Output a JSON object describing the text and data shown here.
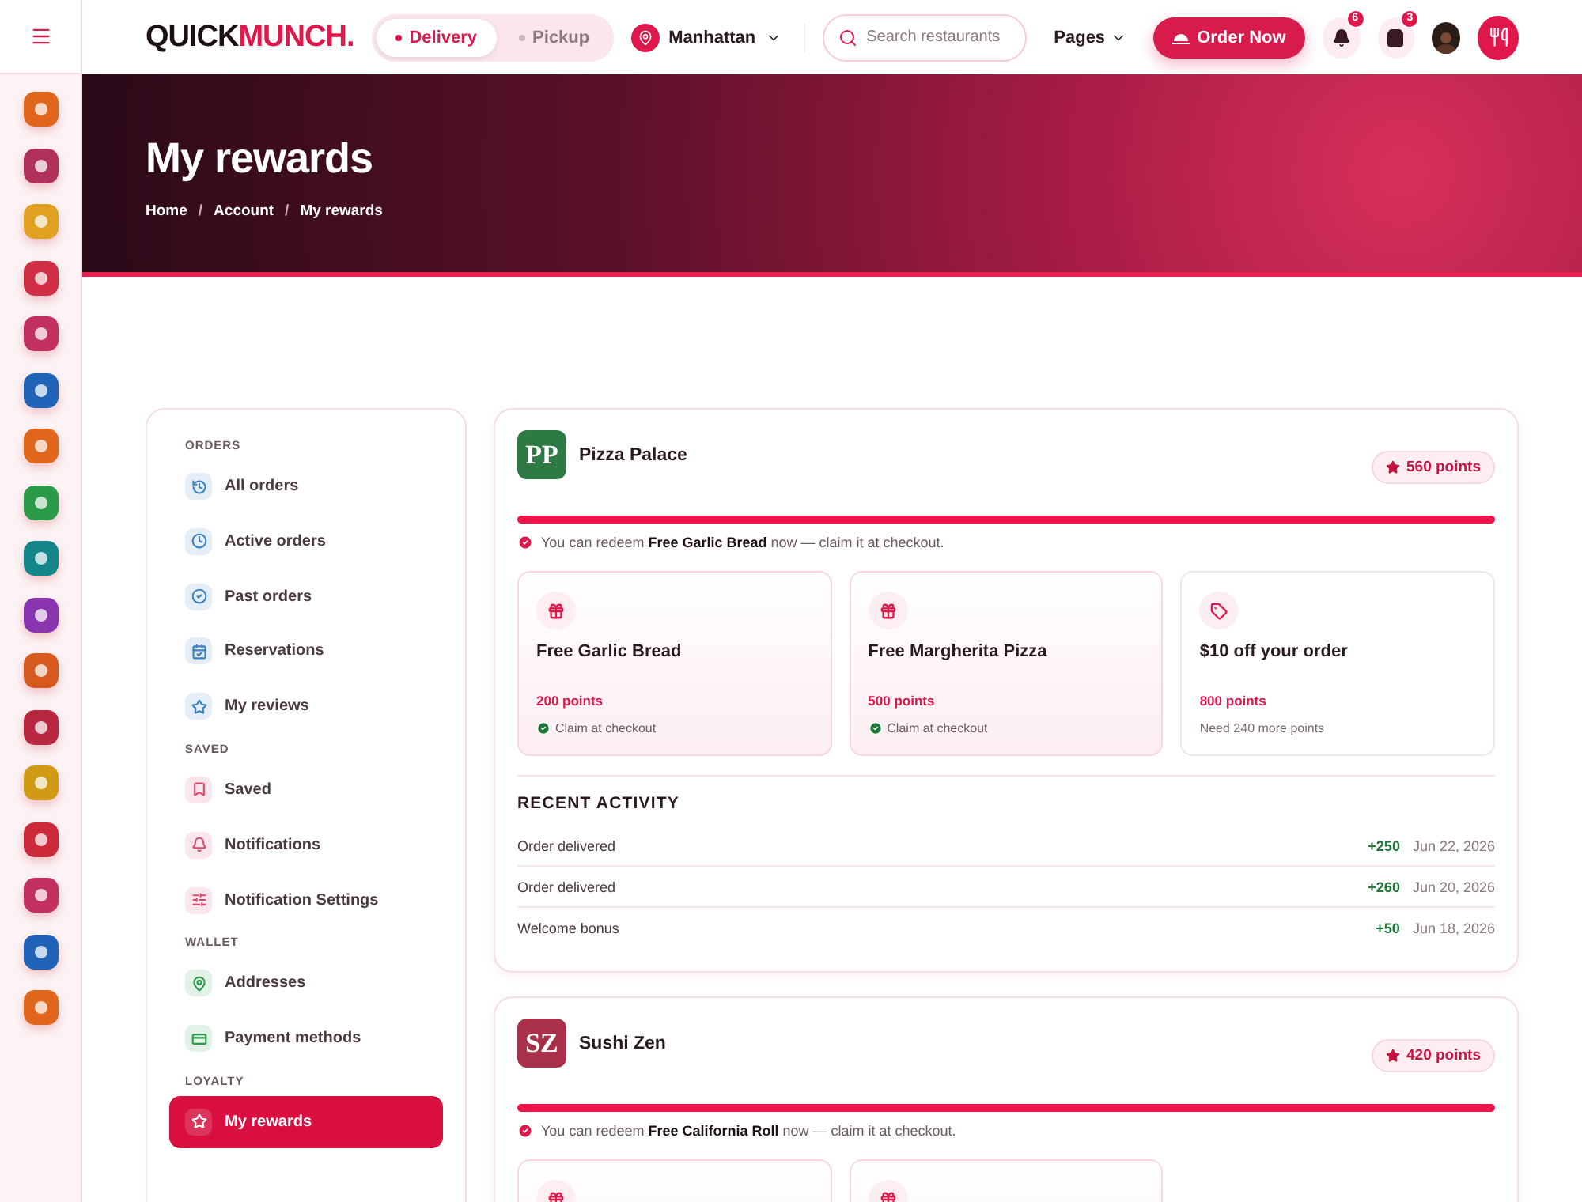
{
  "rail": {
    "items": [
      {
        "color": "#e0661c"
      },
      {
        "color": "#b0315a"
      },
      {
        "color": "#e0a020"
      },
      {
        "color": "#d02e45"
      },
      {
        "color": "#c23060"
      },
      {
        "color": "#1f63b8"
      },
      {
        "color": "#e0661c"
      },
      {
        "color": "#2a9a48"
      },
      {
        "color": "#14868a"
      },
      {
        "color": "#8a35b0"
      },
      {
        "color": "#d65a20"
      },
      {
        "color": "#b8263f"
      },
      {
        "color": "#d09a14"
      },
      {
        "color": "#cc2a3a"
      },
      {
        "color": "#c23060"
      },
      {
        "color": "#1f63b8"
      },
      {
        "color": "#e0661c"
      }
    ]
  },
  "header": {
    "logo": {
      "first": "QUICK",
      "second": "MUNCH."
    },
    "modes": [
      {
        "label": "Delivery",
        "selected": true
      },
      {
        "label": "Pickup",
        "selected": false
      }
    ],
    "location": "Manhattan",
    "search": {
      "placeholder": "Search restaurants"
    },
    "pages": "Pages",
    "order_button": "Order Now",
    "notifications_badge": "6",
    "cart_badge": "3"
  },
  "hero": {
    "title": "My rewards",
    "breadcrumb": [
      {
        "kind": "link",
        "text": "Home"
      },
      {
        "kind": "separator",
        "text": "/"
      },
      {
        "kind": "link",
        "text": "Account"
      },
      {
        "kind": "separator",
        "text": "/"
      },
      {
        "kind": "current",
        "text": "My rewards"
      }
    ]
  },
  "nav": {
    "sections": [
      {
        "title": "ORDERS",
        "items": [
          {
            "label": "All orders",
            "selected": false,
            "color": "#3b82c4"
          },
          {
            "label": "Active orders",
            "selected": false,
            "color": "#3b82c4"
          },
          {
            "label": "Past orders",
            "selected": false,
            "color": "#3b82c4"
          },
          {
            "label": "Reservations",
            "selected": false,
            "color": "#3b82c4"
          },
          {
            "label": "My reviews",
            "selected": false,
            "color": "#3b82c4"
          }
        ]
      },
      {
        "title": "SAVED",
        "items": [
          {
            "label": "Saved",
            "selected": false,
            "color": "#e0466a"
          },
          {
            "label": "Notifications",
            "selected": false,
            "color": "#e0466a"
          },
          {
            "label": "Notification Settings",
            "selected": false,
            "color": "#e0466a"
          }
        ]
      },
      {
        "title": "WALLET",
        "items": [
          {
            "label": "Addresses",
            "selected": false,
            "color": "#2a9a48"
          },
          {
            "label": "Payment methods",
            "selected": false,
            "color": "#2a9a48"
          }
        ]
      },
      {
        "title": "LOYALTY",
        "items": [
          {
            "label": "My rewards",
            "selected": true,
            "color": "#e0466a"
          }
        ]
      }
    ]
  },
  "programs": [
    {
      "logo": "PP",
      "color": "#2e7a45",
      "name": "Pizza Palace",
      "points": "560 points",
      "level": 1,
      "message": "You can redeem **Free Garlic Bread** now — claim it at checkout.",
      "rewards": [
        {
          "kind": "gift",
          "title": "Free Garlic Bread",
          "points": "200 points",
          "claimable": true,
          "note": "Claim at checkout"
        },
        {
          "kind": "gift",
          "title": "Free Margherita Pizza",
          "points": "500 points",
          "claimable": true,
          "note": "Claim at checkout"
        },
        {
          "kind": "tag",
          "title": "$10 off your order",
          "points": "800 points",
          "claimable": false,
          "note": "Need 240 more points"
        }
      ],
      "activity_title": "RECENT ACTIVITY",
      "activity": [
        {
          "label": "Order delivered",
          "points": "+250",
          "date": "Jun 22, 2026"
        },
        {
          "label": "Order delivered",
          "points": "+260",
          "date": "Jun 20, 2026"
        },
        {
          "label": "Welcome bonus",
          "points": "+50",
          "date": "Jun 18, 2026"
        }
      ]
    },
    {
      "logo": "SZ",
      "color": "#a83048",
      "name": "Sushi Zen",
      "points": "420 points",
      "level": 1,
      "message": "You can redeem **Free California Roll** now — claim it at checkout.",
      "rewards": [
        {
          "kind": "gift",
          "claimable": true
        },
        {
          "kind": "gift",
          "claimable": true
        }
      ]
    }
  ]
}
